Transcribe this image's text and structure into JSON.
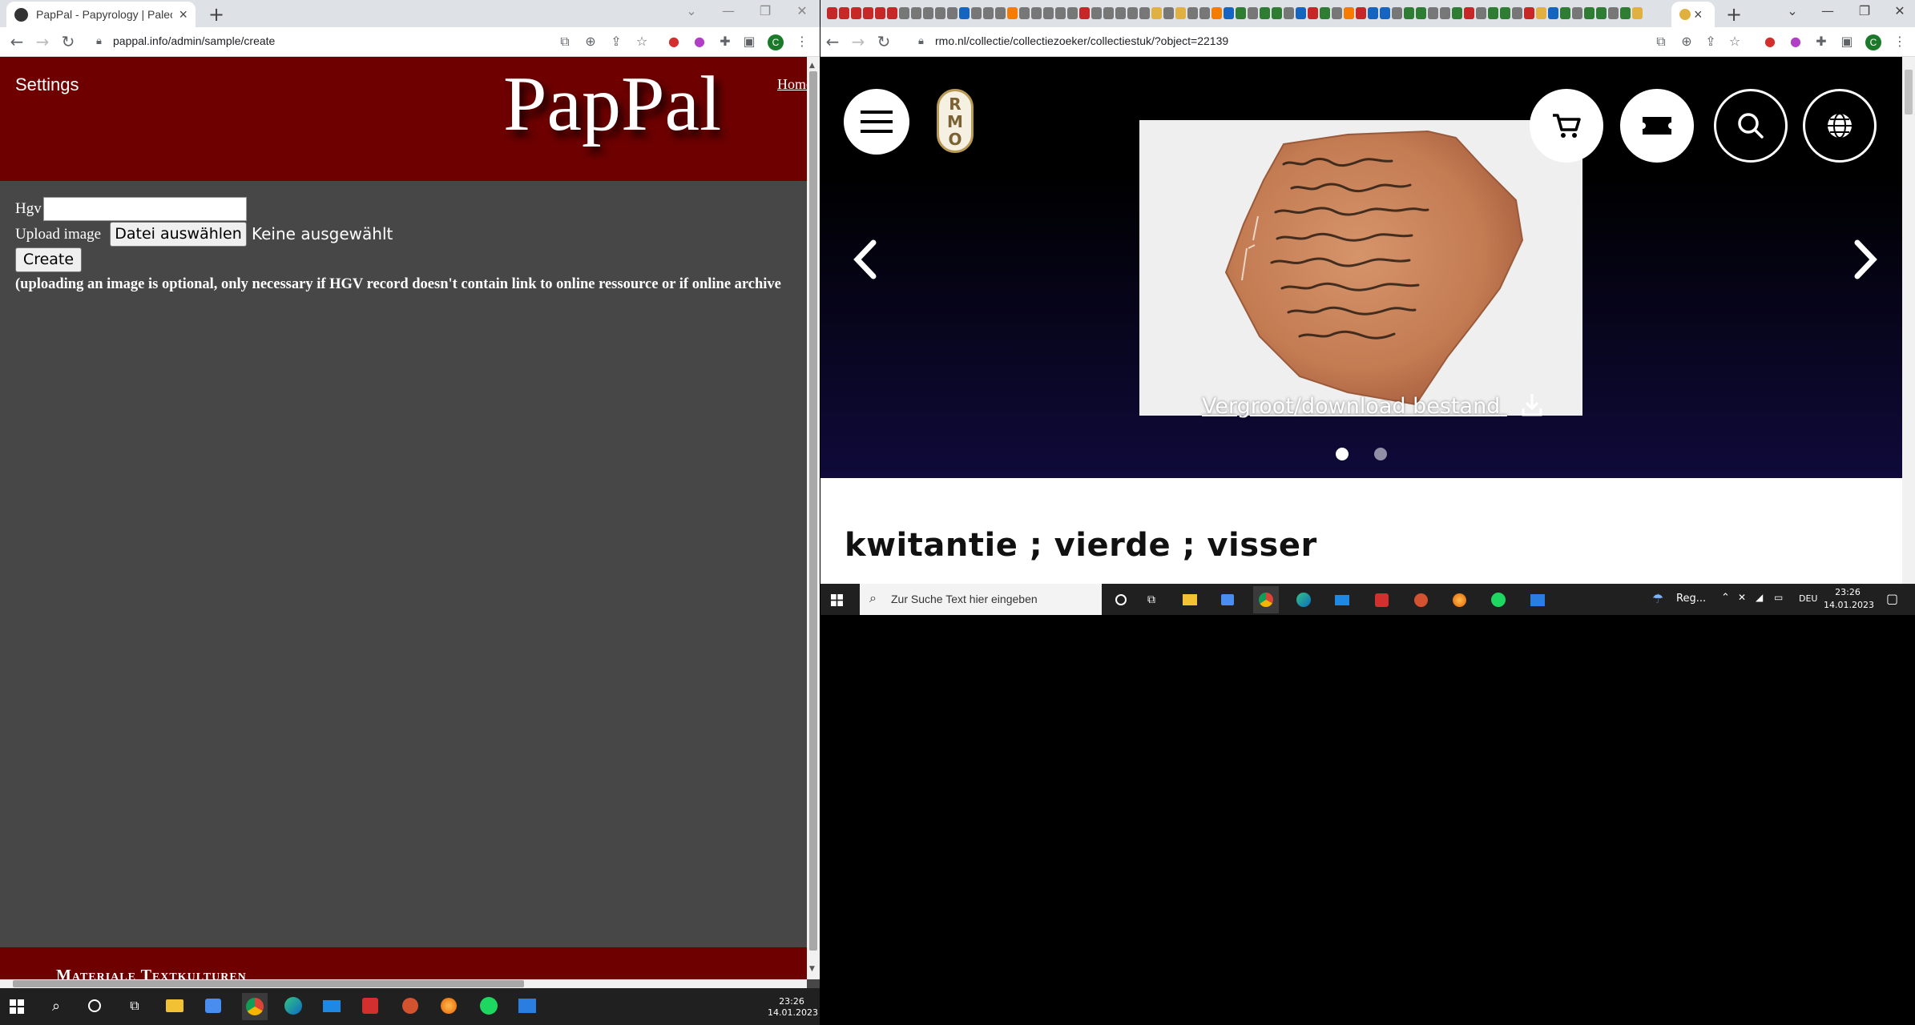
{
  "left_browser": {
    "tab_title": "PapPal - Papyrology | Paleograph",
    "url": "pappal.info/admin/sample/create"
  },
  "pappal": {
    "settings_link": "Settings",
    "logo": "PapPal",
    "home_link": "Home",
    "hgv_label": "Hgv",
    "upload_label": "Upload image",
    "choose_file_button": "Datei auswählen",
    "no_file_selected": "Keine ausgewählt",
    "create_button": "Create",
    "note": "(uploading an image is optional, only necessary if HGV record doesn't contain link to online ressource or if online archive",
    "footer_text": "Materiale Textkulturen"
  },
  "right_browser": {
    "url": "rmo.nl/collectie/collectiezoeker/collectiestuk/?object=22139"
  },
  "rmo": {
    "logo_letters": "RMO",
    "download_link": "Vergroot/download bestand",
    "carousel": {
      "slides": 2,
      "active": 1
    },
    "object_title": "kwitantie ; vierde ; visser"
  },
  "taskbar_left": {
    "time": "23:26",
    "date": "14.01.2023"
  },
  "taskbar_right": {
    "search_placeholder": "Zur Suche Text hier eingeben",
    "weather_text": "Reg...",
    "language": "DEU",
    "time": "23:26",
    "date": "14.01.2023"
  }
}
